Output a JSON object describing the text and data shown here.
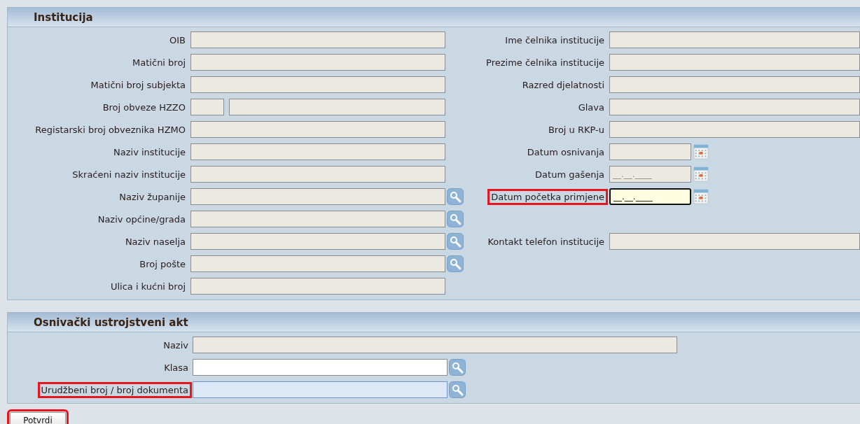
{
  "institucija": {
    "title": "Institucija",
    "rows": [
      {
        "left": {
          "label": "OIB",
          "kind": "text",
          "disabled": true,
          "focused": false,
          "highlighted": false
        },
        "right": {
          "label": "Ime čelnika institucije",
          "kind": "text",
          "disabled": true,
          "focused": false,
          "highlighted": false
        }
      },
      {
        "left": {
          "label": "Matični broj",
          "kind": "text",
          "disabled": true,
          "focused": false,
          "highlighted": false
        },
        "right": {
          "label": "Prezime čelnika institucije",
          "kind": "text",
          "disabled": true,
          "focused": false,
          "highlighted": false
        }
      },
      {
        "left": {
          "label": "Matični broj subjekta",
          "kind": "text",
          "disabled": true,
          "focused": false,
          "highlighted": false
        },
        "right": {
          "label": "Razred djelatnosti",
          "kind": "text",
          "disabled": true,
          "focused": false,
          "highlighted": false
        }
      },
      {
        "left": {
          "label": "Broj obveze HZZO",
          "kind": "split",
          "disabled": true,
          "focused": false,
          "highlighted": false
        },
        "right": {
          "label": "Glava",
          "kind": "text",
          "disabled": true,
          "focused": false,
          "highlighted": false
        }
      },
      {
        "left": {
          "label": "Registarski broj obveznika HZMO",
          "kind": "text",
          "disabled": true,
          "focused": false,
          "highlighted": false
        },
        "right": {
          "label": "Broj u RKP-u",
          "kind": "text",
          "disabled": true,
          "focused": false,
          "highlighted": false
        }
      },
      {
        "left": {
          "label": "Naziv institucije",
          "kind": "text",
          "disabled": true,
          "focused": false,
          "highlighted": false
        },
        "right": {
          "label": "Datum osnivanja",
          "kind": "date",
          "disabled": true,
          "focused": false,
          "highlighted": false
        }
      },
      {
        "left": {
          "label": "Skraćeni naziv institucije",
          "kind": "text",
          "disabled": true,
          "focused": false,
          "highlighted": false
        },
        "right": {
          "label": "Datum gašenja",
          "kind": "date",
          "disabled": true,
          "focused": false,
          "value": "__.__.____",
          "highlighted": false
        }
      },
      {
        "left": {
          "label": "Naziv županije",
          "kind": "lookup",
          "disabled": true,
          "focused": false,
          "highlighted": false
        },
        "right": {
          "label": "Datum početka primjene",
          "kind": "date",
          "disabled": false,
          "focused": true,
          "value": "__.__.____",
          "highlighted": true
        }
      },
      {
        "left": {
          "label": "Naziv općine/grada",
          "kind": "lookup",
          "disabled": true,
          "focused": false,
          "highlighted": false
        }
      },
      {
        "left": {
          "label": "Naziv naselja",
          "kind": "lookup",
          "disabled": true,
          "focused": false,
          "highlighted": false
        },
        "right": {
          "label": "Kontakt telefon institucije",
          "kind": "text",
          "disabled": true,
          "focused": false,
          "highlighted": false
        }
      },
      {
        "left": {
          "label": "Broj pošte",
          "kind": "lookup",
          "disabled": true,
          "focused": false,
          "highlighted": false
        }
      },
      {
        "left": {
          "label": "Ulica i kućni broj",
          "kind": "text",
          "disabled": true,
          "focused": false,
          "highlighted": false
        }
      }
    ]
  },
  "osnivacki_akt": {
    "title": "Osnivački ustrojstveni akt",
    "fields": [
      {
        "label": "Naziv",
        "kind": "wide",
        "disabled": true,
        "focused": false,
        "hovered": false,
        "highlighted": false
      },
      {
        "label": "Klasa",
        "kind": "lookup",
        "disabled": false,
        "focused": false,
        "hovered": false,
        "highlighted": false
      },
      {
        "label": "Urudžbeni broj / broj dokumenta",
        "kind": "lookup",
        "disabled": false,
        "focused": false,
        "hovered": true,
        "highlighted": true
      }
    ]
  },
  "buttons": [
    {
      "label": "Potvrdi",
      "highlighted": true
    }
  ]
}
